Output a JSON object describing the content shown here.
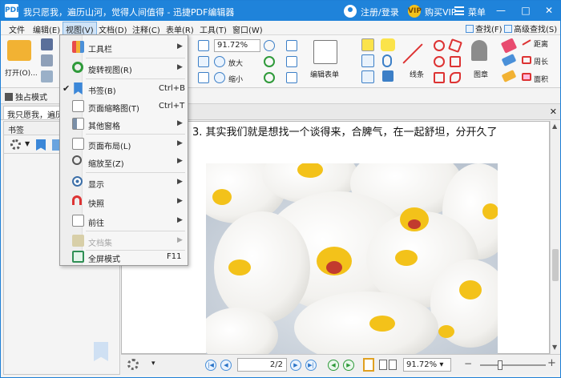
{
  "titlebar": {
    "logo": "PDF",
    "title": "我只愿我，遍历山河，觉得人间值得 - 迅捷PDF编辑器",
    "login": "注册/登录",
    "vip": "购买VIP",
    "menu": "菜单",
    "vip_icon": "VIP",
    "min": "—",
    "max": "□",
    "close": "✕"
  },
  "menubar": {
    "items": [
      "文件",
      "编辑(E)",
      "视图(V)",
      "文档(D)",
      "注释(C)",
      "表单(R)",
      "工具(T)",
      "窗口(W)"
    ],
    "find": "查找(F)",
    "advfind": "高级查找(S)"
  },
  "ribbon": {
    "open": "打开(O)...",
    "zoom_value": "91.72%",
    "zoom_in": "放大",
    "zoom_out": "缩小",
    "form": "编辑表单",
    "line": "线条",
    "stamp": "图章",
    "distance": "距离",
    "perimeter": "周长",
    "area": "面积"
  },
  "mode": {
    "label": "独占模式"
  },
  "tab": {
    "label": "我只愿我，遍历山"
  },
  "sidebar": {
    "title": "书签"
  },
  "document": {
    "text": "3. 其实我们就是想找一个谈得来，合脾气，在一起舒坦，分开久了"
  },
  "status": {
    "page": "2",
    "page_total": "2",
    "zoom": "91.72%"
  },
  "view_menu": [
    {
      "label": "工具栏",
      "shortcut": "",
      "submenu": true,
      "checked": false,
      "disabled": false
    },
    {
      "label": "旋转视图(R)",
      "shortcut": "",
      "submenu": true,
      "checked": false,
      "disabled": false
    },
    {
      "label": "书签(B)",
      "shortcut": "Ctrl+B",
      "submenu": false,
      "checked": true,
      "disabled": false
    },
    {
      "label": "页面缩略图(T)",
      "shortcut": "Ctrl+T",
      "submenu": false,
      "checked": false,
      "disabled": false
    },
    {
      "label": "其他窗格",
      "shortcut": "",
      "submenu": true,
      "checked": false,
      "disabled": false
    },
    {
      "label": "页面布局(L)",
      "shortcut": "",
      "submenu": true,
      "checked": false,
      "disabled": false
    },
    {
      "label": "缩放至(Z)",
      "shortcut": "",
      "submenu": true,
      "checked": false,
      "disabled": false
    },
    {
      "label": "显示",
      "shortcut": "",
      "submenu": true,
      "checked": false,
      "disabled": false
    },
    {
      "label": "快照",
      "shortcut": "",
      "submenu": true,
      "checked": false,
      "disabled": false
    },
    {
      "label": "前往",
      "shortcut": "",
      "submenu": true,
      "checked": false,
      "disabled": false
    },
    {
      "label": "文档集",
      "shortcut": "",
      "submenu": true,
      "checked": false,
      "disabled": true
    },
    {
      "label": "全屏模式",
      "shortcut": "F11",
      "submenu": false,
      "checked": false,
      "disabled": false
    }
  ],
  "colors": {
    "accent": "#1f83da",
    "menu_bg": "#f6f6f6",
    "vip_gold": "#f4c21c"
  }
}
